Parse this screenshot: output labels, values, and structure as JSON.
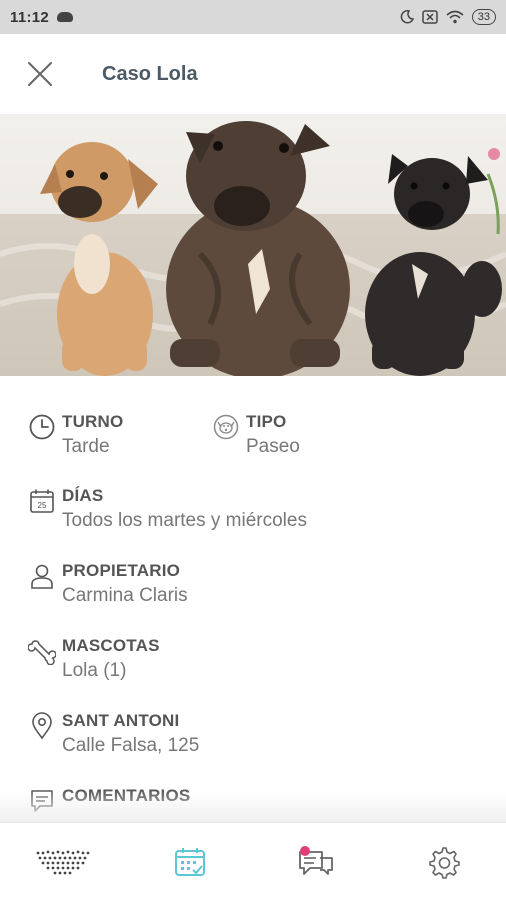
{
  "status_bar": {
    "time": "11:12",
    "battery": "33"
  },
  "header": {
    "title": "Caso Lola"
  },
  "hero": {
    "image": "three-staffordshire-puppies-photo"
  },
  "details": {
    "turno": {
      "label": "TURNO",
      "value": "Tarde"
    },
    "tipo": {
      "label": "TIPO",
      "value": "Paseo"
    },
    "dias": {
      "label": "DÍAS",
      "value": "Todos los martes y miércoles"
    },
    "propietario": {
      "label": "PROPIETARIO",
      "value": "Carmina Claris"
    },
    "mascotas": {
      "label": "MASCOTAS",
      "value": "Lola (1)"
    },
    "direccion": {
      "label": "SANT ANTONI",
      "value": "Calle Falsa, 125"
    },
    "comentarios": {
      "label": "COMENTARIOS"
    }
  },
  "calendar_day": "25",
  "colors": {
    "accent": "#5ec6d4",
    "badge": "#e23c77",
    "title": "#4d5a66"
  }
}
